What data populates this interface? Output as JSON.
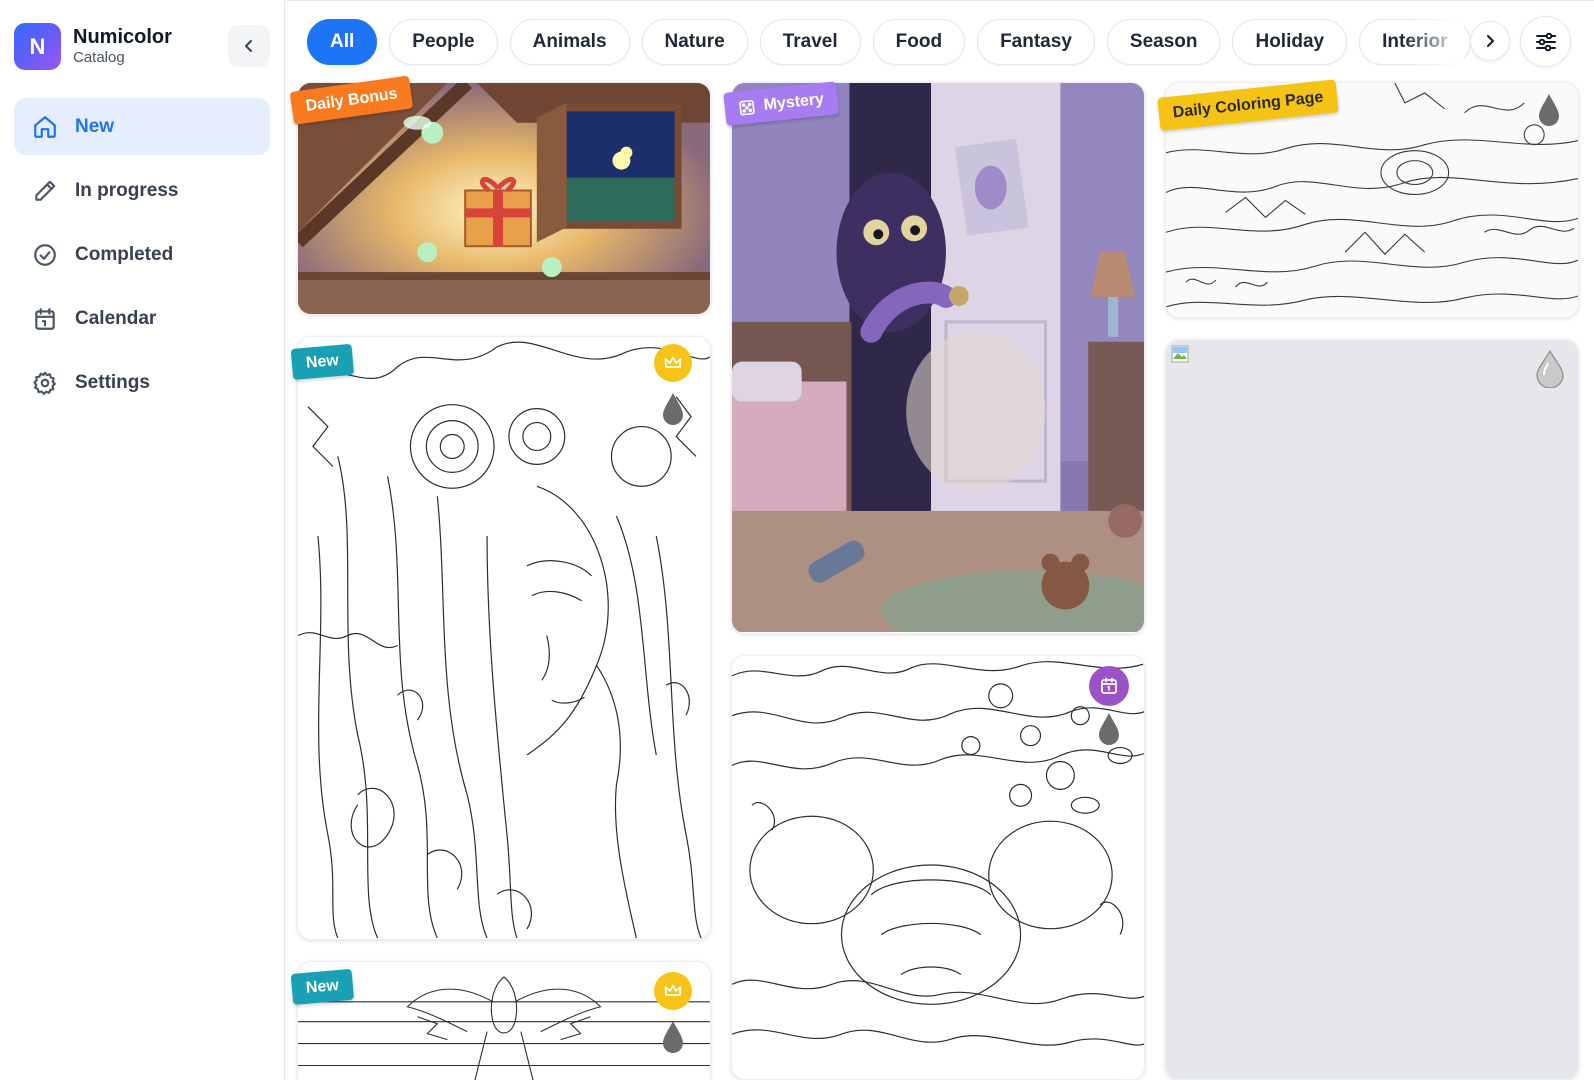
{
  "app": {
    "logo_letter": "N",
    "name": "Numicolor",
    "subtitle": "Catalog"
  },
  "sidebar": {
    "collapse_icon": "chevron-left-icon",
    "items": [
      {
        "label": "New",
        "icon": "home-icon",
        "active": true
      },
      {
        "label": "In progress",
        "icon": "pencil-icon",
        "active": false
      },
      {
        "label": "Completed",
        "icon": "check-circle-icon",
        "active": false
      },
      {
        "label": "Calendar",
        "icon": "calendar-icon",
        "active": false
      },
      {
        "label": "Settings",
        "icon": "gear-icon",
        "active": false
      }
    ]
  },
  "categories": {
    "chips": [
      "All",
      "People",
      "Animals",
      "Nature",
      "Travel",
      "Food",
      "Fantasy",
      "Season",
      "Holiday",
      "Interior"
    ],
    "selected": "All",
    "next_icon": "chevron-right-icon",
    "filter_icon": "sliders-icon"
  },
  "cards": {
    "daily_bonus": {
      "tag": "Daily Bonus",
      "subject": "attic with fairies and gift box"
    },
    "mystery": {
      "tag": "Mystery",
      "tag_icon": "mystery-box-icon",
      "subject": "monster peeking from closet in bedroom"
    },
    "daily_page": {
      "tag": "Daily Coloring Page",
      "icon": "paint-drop-icon"
    },
    "portrait": {
      "tag": "New",
      "badge_icon": "crown-icon",
      "icon": "paint-drop-icon"
    },
    "abstract": {
      "badge_icon": "calendar-icon",
      "icon": "paint-drop-icon"
    },
    "placeholder": {
      "icon": "paint-drop-icon",
      "broken_image_icon": "broken-image-icon"
    },
    "angel": {
      "tag": "New",
      "badge_icon": "crown-icon",
      "icon": "paint-drop-icon"
    }
  },
  "colors": {
    "accent": "#1d74f5",
    "nav_active_bg": "#e4eefd",
    "tag_bonus": "#f97a1f",
    "tag_mystery": "#a77cf2",
    "tag_daily": "#f5c313",
    "tag_new": "#1aa0b4",
    "badge_crown": "#f7c316",
    "badge_calendar": "#9b52c9"
  }
}
